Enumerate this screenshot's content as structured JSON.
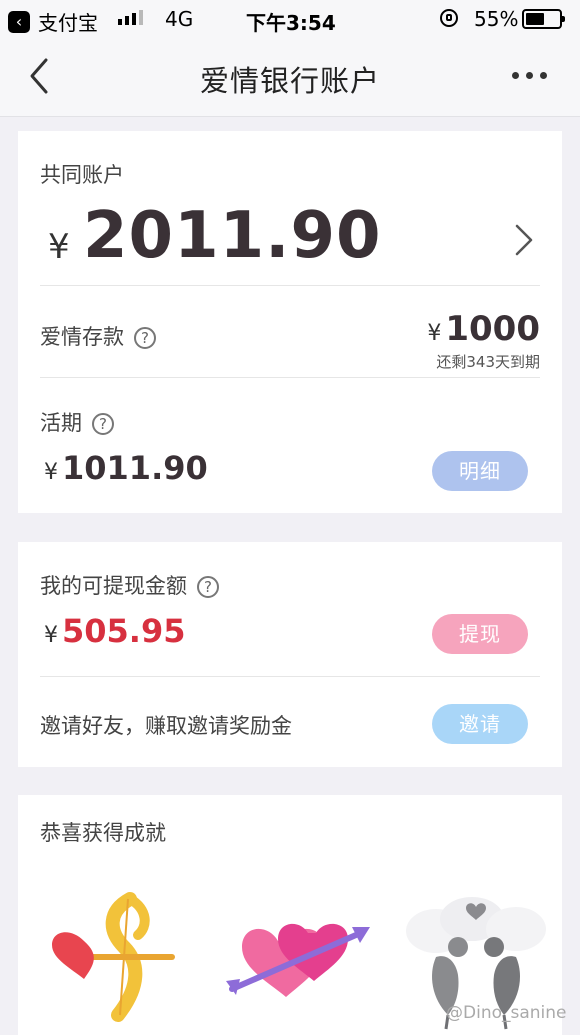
{
  "status_bar": {
    "back_app": "支付宝",
    "network": "4G",
    "time": "下午3:54",
    "battery": "55%",
    "battery_level": 0.55
  },
  "nav": {
    "title": "爱情银行账户"
  },
  "joint_account": {
    "label": "共同账户",
    "currency": "¥",
    "balance": "2011.90"
  },
  "love_deposit": {
    "label": "爱情存款",
    "currency": "¥",
    "amount": "1000",
    "due_note": "还剩343天到期"
  },
  "current": {
    "label": "活期",
    "currency": "¥",
    "amount": "1011.90",
    "detail_button": "明细"
  },
  "withdrawable": {
    "label": "我的可提现金额",
    "currency": "¥",
    "amount": "505.95",
    "withdraw_button": "提现"
  },
  "invite": {
    "text": "邀请好友，赚取邀请奖励金",
    "button": "邀请"
  },
  "achievements": {
    "title": "恭喜获得成就",
    "items": [
      "cupid-bow-icon",
      "hearts-arrow-icon",
      "doves-icon"
    ]
  },
  "watermark": "@Dino_sanine",
  "colors": {
    "amount_dark": "#3a3136",
    "amount_red": "#d7303f",
    "detail_blue": "#aec3ee",
    "withdraw_pink": "#f6a4bd",
    "invite_blue": "#a9d6f8"
  }
}
